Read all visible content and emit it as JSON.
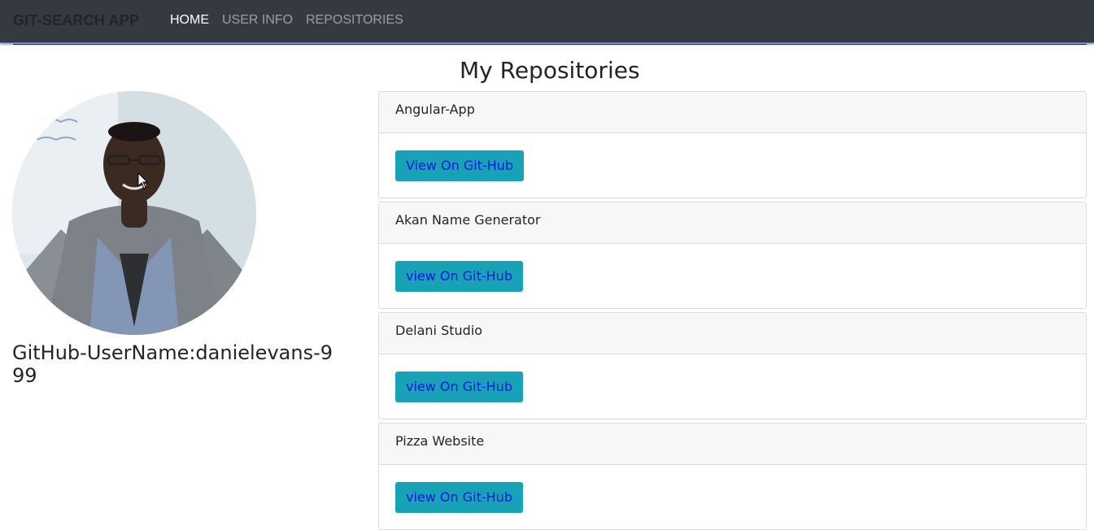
{
  "navbar": {
    "brand": "GIT-SEARCH APP",
    "links": [
      {
        "label": "HOME",
        "active": true
      },
      {
        "label": "USER INFO",
        "active": false
      },
      {
        "label": "REPOSITORIES",
        "active": false
      }
    ]
  },
  "profile": {
    "username_text": "GitHub-UserName:danielevans-999"
  },
  "repositories": {
    "title": "My Repositories",
    "items": [
      {
        "name": "Angular-App",
        "button_label": "View On Git-Hub"
      },
      {
        "name": "Akan Name Generator",
        "button_label": "view On Git-Hub"
      },
      {
        "name": "Delani Studio",
        "button_label": "view On Git-Hub"
      },
      {
        "name": "Pizza Website",
        "button_label": "view On Git-Hub"
      }
    ]
  },
  "colors": {
    "navbar_bg": "#343a40",
    "button_bg": "#17a2b8",
    "button_text": "#0b1bd6",
    "card_header_bg": "#f7f7f7"
  }
}
